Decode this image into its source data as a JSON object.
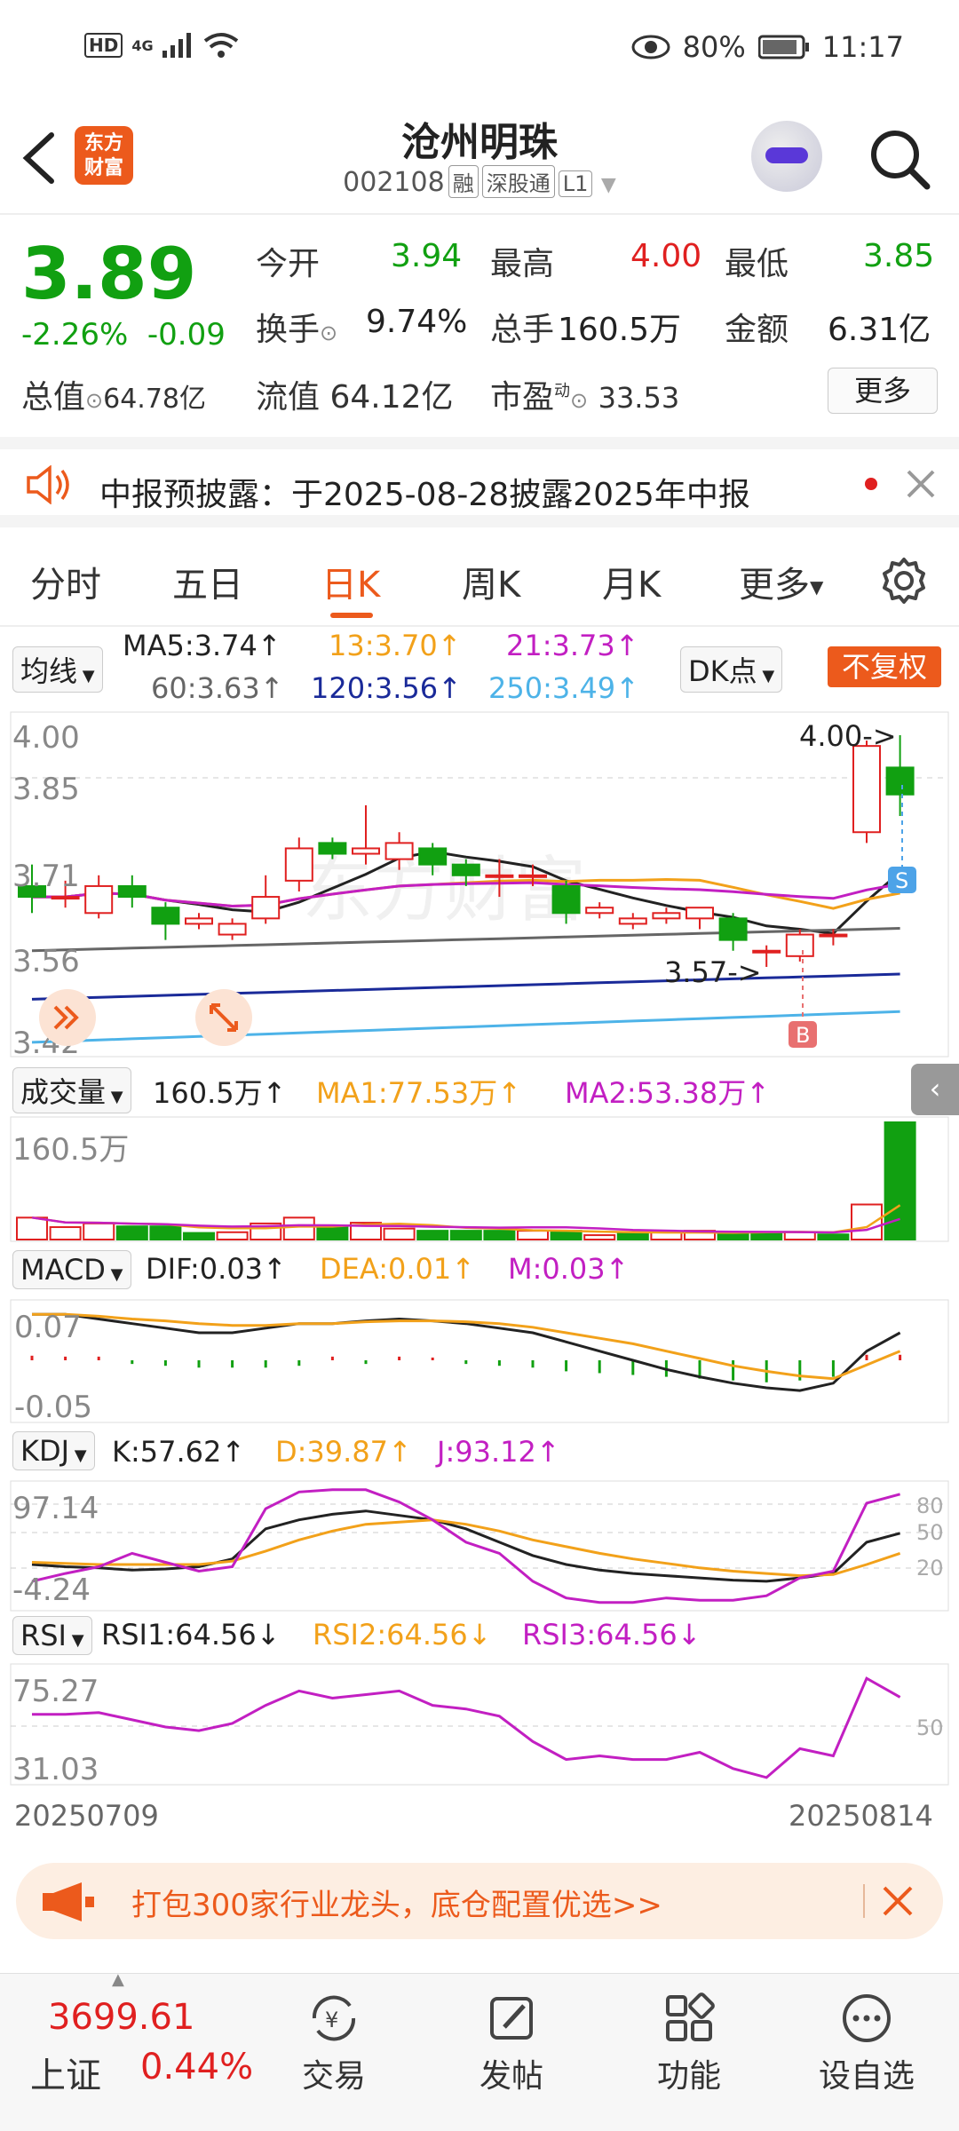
{
  "status_bar": {
    "hd": "HD",
    "net": "4G",
    "battery": "80%",
    "time": "11:17"
  },
  "header": {
    "logo_line1": "东方",
    "logo_line2": "财富",
    "stock_name": "沧州明珠",
    "stock_code": "002108",
    "tags": [
      "融",
      "深股通",
      "L1"
    ]
  },
  "quote": {
    "price": "3.89",
    "change_pct": "-2.26%",
    "change": "-0.09",
    "open_label": "今开",
    "open": "3.94",
    "high_label": "最高",
    "high": "4.00",
    "low_label": "最低",
    "low": "3.85",
    "turnover_label": "换手",
    "turnover": "9.74%",
    "volume_label": "总手",
    "volume": "160.5万",
    "amount_label": "金额",
    "amount": "6.31亿",
    "mktcap_label": "总值",
    "mktcap": "64.78亿",
    "float_label": "流值",
    "float_cap": "64.12亿",
    "pe_label": "市盈",
    "pe_sup": "动",
    "pe": "33.53",
    "more": "更多"
  },
  "notice": {
    "text": "中报预披露：于2025-08-28披露2025年中报"
  },
  "tabs": [
    "分时",
    "五日",
    "日K",
    "周K",
    "月K",
    "更多"
  ],
  "ma_row": {
    "dropdown": "均线",
    "ma5": "MA5:3.74↑",
    "ma13": "13:3.70↑",
    "ma21": "21:3.73↑",
    "ma60": "60:3.63↑",
    "ma120": "120:3.56↑",
    "ma250": "250:3.49↑",
    "dk": "DK点",
    "fq": "不复权"
  },
  "kline": {
    "axis": [
      "4.00",
      "3.85",
      "3.71",
      "3.56",
      "3.42"
    ],
    "high_note": "4.00->",
    "low_note": "3.57->",
    "sell_mark": "S",
    "buy_mark": "B",
    "watermark": "东方财富"
  },
  "volume_row": {
    "dropdown": "成交量",
    "vol": "160.5万↑",
    "ma1": "MA1:77.53万↑",
    "ma2": "MA2:53.38万↑",
    "axis": "160.5万"
  },
  "macd_row": {
    "dropdown": "MACD",
    "dif": "DIF:0.03↑",
    "dea": "DEA:0.01↑",
    "m": "M:0.03↑",
    "axis_top": "0.07",
    "axis_bot": "-0.05"
  },
  "kdj_row": {
    "dropdown": "KDJ",
    "k": "K:57.62↑",
    "d": "D:39.87↑",
    "j": "J:93.12↑",
    "axis_top": "97.14",
    "axis_bot": "-4.24",
    "lvl80": "80",
    "lvl50": "50",
    "lvl20": "20"
  },
  "rsi_row": {
    "dropdown": "RSI",
    "r1": "RSI1:64.56↓",
    "r2": "RSI2:64.56↓",
    "r3": "RSI3:64.56↓",
    "axis_top": "75.27",
    "axis_bot": "31.03",
    "lvl50": "50"
  },
  "dates": {
    "start": "20250709",
    "end": "20250814"
  },
  "ad": {
    "text": "打包300家行业龙头，底仓配置优选>>"
  },
  "bottom_nav": {
    "index_value": "3699.61",
    "index_name": "上证",
    "index_change": "0.44%",
    "items": [
      "交易",
      "发帖",
      "功能",
      "设自选"
    ]
  },
  "colors": {
    "up": "#e02020",
    "down": "#11a011",
    "brand": "#ec5a1c"
  },
  "chart_data": {
    "type": "candlestick",
    "candles": [
      {
        "o": 3.72,
        "c": 3.7,
        "h": 3.76,
        "l": 3.67
      },
      {
        "o": 3.7,
        "c": 3.7,
        "h": 3.73,
        "l": 3.68
      },
      {
        "o": 3.67,
        "c": 3.72,
        "h": 3.74,
        "l": 3.66
      },
      {
        "o": 3.72,
        "c": 3.7,
        "h": 3.74,
        "l": 3.68
      },
      {
        "o": 3.68,
        "c": 3.65,
        "h": 3.69,
        "l": 3.62
      },
      {
        "o": 3.65,
        "c": 3.66,
        "h": 3.67,
        "l": 3.64
      },
      {
        "o": 3.63,
        "c": 3.65,
        "h": 3.66,
        "l": 3.62
      },
      {
        "o": 3.66,
        "c": 3.7,
        "h": 3.74,
        "l": 3.65
      },
      {
        "o": 3.73,
        "c": 3.79,
        "h": 3.81,
        "l": 3.71
      },
      {
        "o": 3.8,
        "c": 3.78,
        "h": 3.81,
        "l": 3.77
      },
      {
        "o": 3.78,
        "c": 3.79,
        "h": 3.87,
        "l": 3.76
      },
      {
        "o": 3.77,
        "c": 3.8,
        "h": 3.82,
        "l": 3.75
      },
      {
        "o": 3.79,
        "c": 3.76,
        "h": 3.8,
        "l": 3.74
      },
      {
        "o": 3.76,
        "c": 3.74,
        "h": 3.77,
        "l": 3.72
      },
      {
        "o": 3.74,
        "c": 3.74,
        "h": 3.77,
        "l": 3.7
      },
      {
        "o": 3.74,
        "c": 3.74,
        "h": 3.76,
        "l": 3.72
      },
      {
        "o": 3.72,
        "c": 3.67,
        "h": 3.73,
        "l": 3.65
      },
      {
        "o": 3.67,
        "c": 3.68,
        "h": 3.69,
        "l": 3.66
      },
      {
        "o": 3.65,
        "c": 3.66,
        "h": 3.67,
        "l": 3.64
      },
      {
        "o": 3.66,
        "c": 3.67,
        "h": 3.68,
        "l": 3.65
      },
      {
        "o": 3.66,
        "c": 3.68,
        "h": 3.68,
        "l": 3.64
      },
      {
        "o": 3.66,
        "c": 3.62,
        "h": 3.67,
        "l": 3.6
      },
      {
        "o": 3.6,
        "c": 3.6,
        "h": 3.61,
        "l": 3.57
      },
      {
        "o": 3.59,
        "c": 3.63,
        "h": 3.64,
        "l": 3.58
      },
      {
        "o": 3.63,
        "c": 3.63,
        "h": 3.64,
        "l": 3.61
      },
      {
        "o": 3.82,
        "c": 3.98,
        "h": 3.99,
        "l": 3.8
      },
      {
        "o": 3.94,
        "c": 3.89,
        "h": 4.0,
        "l": 3.85
      }
    ],
    "ylim": [
      3.42,
      4.0
    ],
    "volume": [
      30,
      17,
      22,
      18,
      18,
      9,
      10,
      22,
      30,
      18,
      23,
      15,
      12,
      12,
      12,
      12,
      12,
      6,
      8,
      10,
      12,
      10,
      10,
      10,
      7,
      48,
      160.5
    ],
    "vol_up": [
      1,
      1,
      1,
      0,
      0,
      0,
      1,
      1,
      1,
      0,
      1,
      1,
      0,
      0,
      0,
      1,
      0,
      1,
      0,
      1,
      1,
      0,
      0,
      1,
      0,
      1,
      0
    ],
    "macd_bars": [
      0.005,
      0.004,
      0.004,
      -0.004,
      -0.006,
      -0.008,
      -0.008,
      -0.008,
      -0.006,
      0.004,
      -0.004,
      0.004,
      0.003,
      -0.004,
      -0.006,
      -0.008,
      -0.012,
      -0.014,
      -0.016,
      -0.018,
      -0.02,
      -0.022,
      -0.024,
      -0.022,
      -0.018,
      0.006,
      0.006
    ],
    "dif": [
      0.05,
      0.05,
      0.045,
      0.04,
      0.035,
      0.03,
      0.03,
      0.035,
      0.04,
      0.04,
      0.043,
      0.045,
      0.043,
      0.04,
      0.035,
      0.03,
      0.02,
      0.01,
      0.0,
      -0.01,
      -0.018,
      -0.025,
      -0.03,
      -0.033,
      -0.025,
      0.01,
      0.03
    ],
    "dea": [
      0.05,
      0.05,
      0.048,
      0.045,
      0.043,
      0.04,
      0.038,
      0.038,
      0.04,
      0.04,
      0.042,
      0.043,
      0.043,
      0.042,
      0.04,
      0.036,
      0.03,
      0.024,
      0.018,
      0.01,
      0.002,
      -0.006,
      -0.012,
      -0.017,
      -0.02,
      -0.005,
      0.01
    ],
    "kdj_k": [
      30,
      28,
      27,
      25,
      26,
      28,
      35,
      62,
      70,
      75,
      78,
      74,
      70,
      62,
      50,
      38,
      30,
      25,
      22,
      20,
      18,
      16,
      15,
      18,
      22,
      50,
      58
    ],
    "kdj_d": [
      32,
      31,
      30,
      30,
      30,
      30,
      33,
      42,
      52,
      60,
      66,
      68,
      70,
      66,
      60,
      52,
      46,
      40,
      35,
      31,
      27,
      24,
      22,
      20,
      21,
      30,
      40
    ],
    "kdj_j": [
      15,
      22,
      28,
      40,
      32,
      24,
      28,
      80,
      95,
      97,
      97,
      86,
      70,
      50,
      40,
      15,
      0,
      -4,
      -4,
      0,
      -2,
      -2,
      2,
      18,
      24,
      85,
      93
    ],
    "rsi": [
      55,
      55,
      56,
      52,
      48,
      46,
      50,
      60,
      68,
      64,
      66,
      68,
      60,
      58,
      54,
      40,
      30,
      32,
      30,
      30,
      34,
      25,
      20,
      36,
      32,
      75,
      64.56
    ]
  }
}
